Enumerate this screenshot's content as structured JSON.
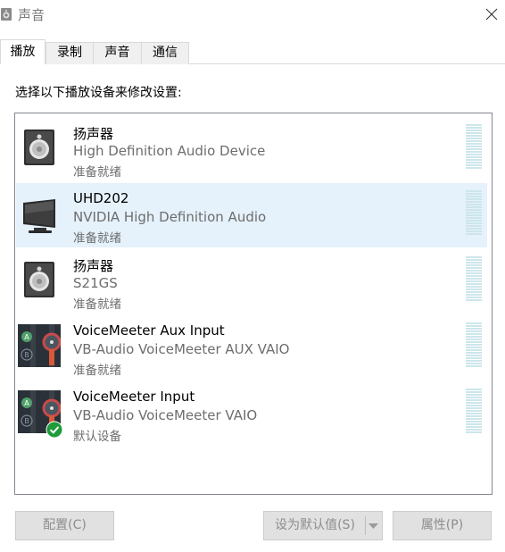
{
  "window": {
    "title": "声音"
  },
  "tabs": [
    {
      "label": "播放",
      "active": true
    },
    {
      "label": "录制",
      "active": false
    },
    {
      "label": "声音",
      "active": false
    },
    {
      "label": "通信",
      "active": false
    }
  ],
  "instruction": "选择以下播放设备来修改设置:",
  "devices": [
    {
      "name": "扬声器",
      "description": "High Definition Audio Device",
      "status": "准备就绪",
      "icon": "speaker-icon",
      "selected": false,
      "default": false
    },
    {
      "name": "UHD202",
      "description": "NVIDIA High Definition Audio",
      "status": "准备就绪",
      "icon": "monitor-icon",
      "selected": true,
      "default": false
    },
    {
      "name": "扬声器",
      "description": "S21GS",
      "status": "准备就绪",
      "icon": "speaker-icon",
      "selected": false,
      "default": false
    },
    {
      "name": "VoiceMeeter Aux Input",
      "description": "VB-Audio VoiceMeeter AUX VAIO",
      "status": "准备就绪",
      "icon": "voicemeeter-icon",
      "selected": false,
      "default": false
    },
    {
      "name": "VoiceMeeter Input",
      "description": "VB-Audio VoiceMeeter VAIO",
      "status": "默认设备",
      "icon": "voicemeeter-icon",
      "selected": false,
      "default": true
    }
  ],
  "buttons": {
    "configure": "配置(C)",
    "set_default": "设为默认值(S)",
    "properties": "属性(P)"
  },
  "colors": {
    "selection": "#e5f1fb",
    "meter": "#cde6ec",
    "default_badge": "#1e9b3a"
  }
}
